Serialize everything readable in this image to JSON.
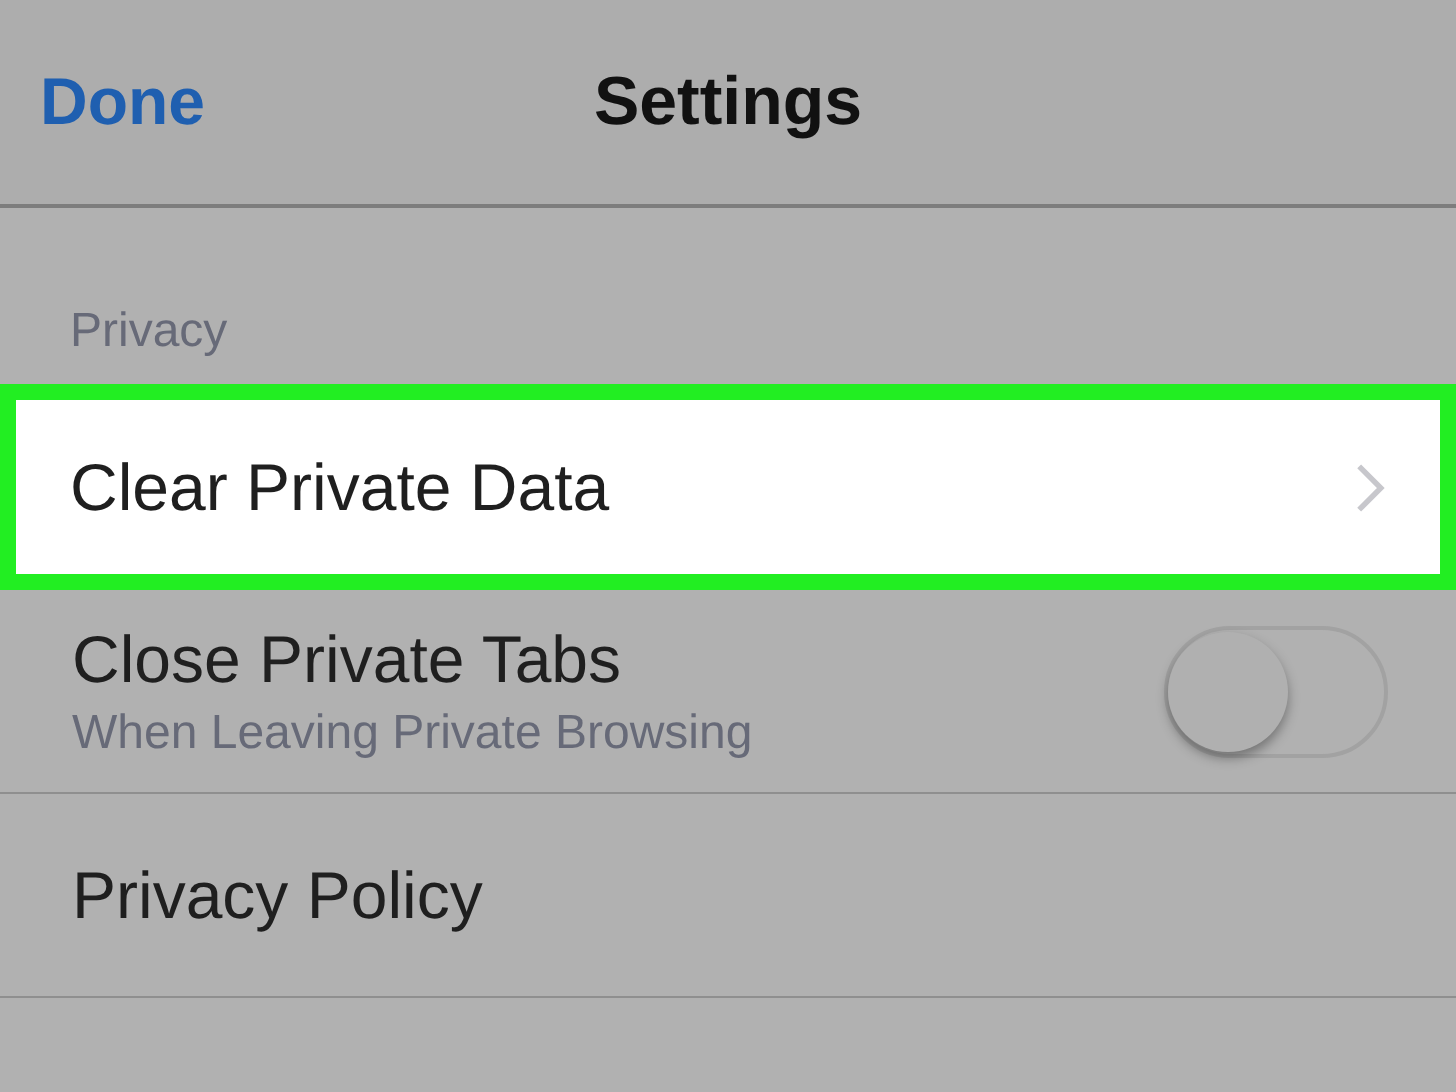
{
  "nav_bar": {
    "done_button": "Done",
    "title": "Settings"
  },
  "section": {
    "header": "Privacy",
    "rows": [
      {
        "kind": "disclosure",
        "title": "Clear Private Data",
        "highlighted": true
      },
      {
        "kind": "toggle",
        "title": "Close Private Tabs",
        "subtitle": "When Leaving Private Browsing",
        "on": false
      },
      {
        "kind": "plain",
        "title": "Privacy Policy"
      }
    ]
  }
}
